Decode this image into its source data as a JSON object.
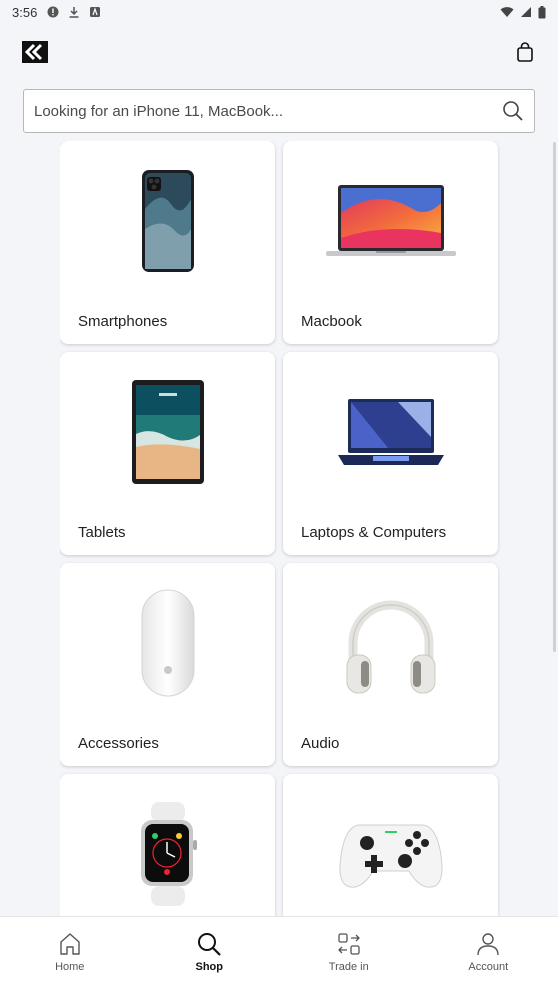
{
  "status_bar": {
    "time": "3:56"
  },
  "search": {
    "placeholder": "Looking for an iPhone 11, MacBook..."
  },
  "categories": [
    {
      "label": "Smartphones",
      "icon": "smartphone-icon"
    },
    {
      "label": "Macbook",
      "icon": "macbook-icon"
    },
    {
      "label": "Tablets",
      "icon": "tablet-icon"
    },
    {
      "label": "Laptops & Computers",
      "icon": "laptop-icon"
    },
    {
      "label": "Accessories",
      "icon": "mouse-icon"
    },
    {
      "label": "Audio",
      "icon": "headphones-icon"
    },
    {
      "label": "",
      "icon": "smartwatch-icon"
    },
    {
      "label": "",
      "icon": "game-controller-icon"
    }
  ],
  "bottom_nav": [
    {
      "label": "Home",
      "icon": "home-icon"
    },
    {
      "label": "Shop",
      "icon": "search-icon",
      "active": true
    },
    {
      "label": "Trade in",
      "icon": "trade-in-icon"
    },
    {
      "label": "Account",
      "icon": "account-icon"
    }
  ]
}
